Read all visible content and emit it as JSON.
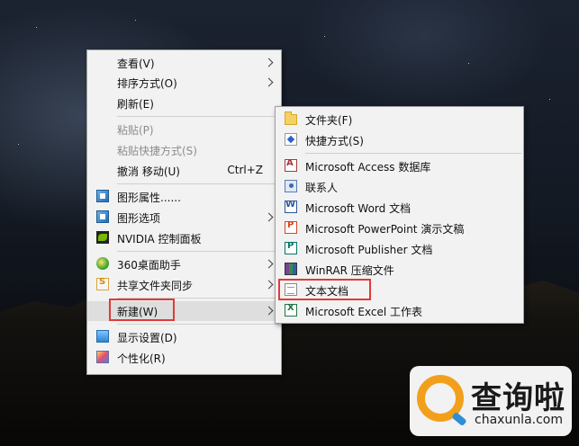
{
  "main_menu": {
    "items": [
      {
        "label": "查看(V)"
      },
      {
        "label": "排序方式(O)"
      },
      {
        "label": "刷新(E)"
      },
      {
        "label": "粘贴(P)"
      },
      {
        "label": "粘贴快捷方式(S)"
      },
      {
        "label": "撤消 移动(U)",
        "shortcut": "Ctrl+Z"
      },
      {
        "label": "图形属性......"
      },
      {
        "label": "图形选项"
      },
      {
        "label": "NVIDIA 控制面板"
      },
      {
        "label": "360桌面助手"
      },
      {
        "label": "共享文件夹同步"
      },
      {
        "label": "新建(W)"
      },
      {
        "label": "显示设置(D)"
      },
      {
        "label": "个性化(R)"
      }
    ]
  },
  "sub_menu": {
    "items": [
      {
        "label": "文件夹(F)"
      },
      {
        "label": "快捷方式(S)"
      },
      {
        "label": "Microsoft Access 数据库"
      },
      {
        "label": "联系人"
      },
      {
        "label": "Microsoft Word 文档"
      },
      {
        "label": "Microsoft PowerPoint 演示文稿"
      },
      {
        "label": "Microsoft Publisher 文档"
      },
      {
        "label": "WinRAR 压缩文件"
      },
      {
        "label": "文本文档"
      },
      {
        "label": "Microsoft Excel 工作表"
      }
    ]
  },
  "watermark": {
    "title": "查询啦",
    "url": "chaxunla.com"
  },
  "colors": {
    "menu_bg": "#f2f2f2",
    "highlight": "#dedede",
    "disabled_text": "#8c8c8c",
    "annotation_red": "#e03a3a"
  }
}
